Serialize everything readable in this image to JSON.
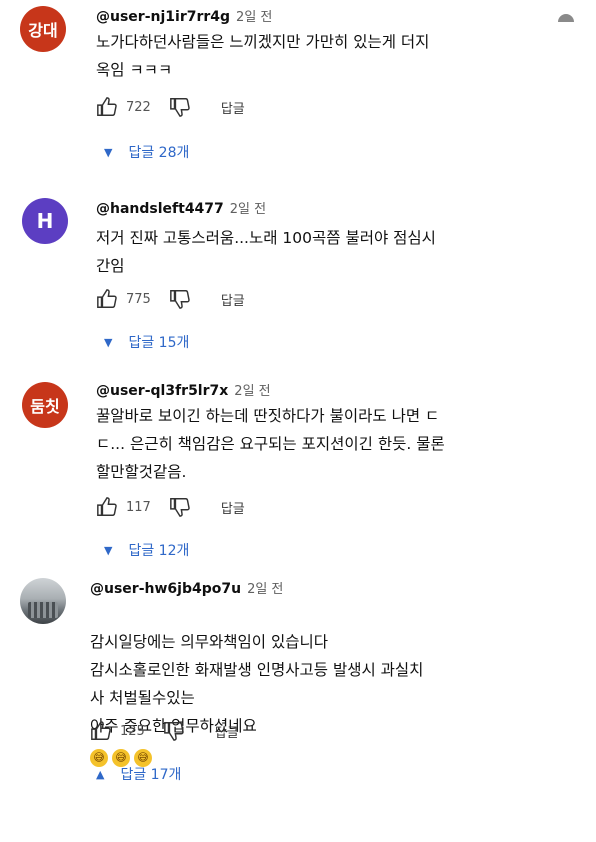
{
  "comments": [
    {
      "avatar_text": "강대",
      "avatar_color": "#c7361a",
      "handle": "@user-nj1ir7rr4g",
      "time": "2일 전",
      "text": "노가다하던사람들은 느끼겠지만 가만히 있는게 더지\n옥임 ㅋㅋㅋ",
      "likes": "722",
      "reply_label": "답글",
      "replies_label": "답글 28개"
    },
    {
      "avatar_text": "H",
      "avatar_color": "#5c3ec2",
      "handle": "@handsleft4477",
      "time": "2일 전",
      "text": "저거 진짜 고통스러움...노래 100곡쯤 불러야 점심시\n간임",
      "likes": "775",
      "reply_label": "답글",
      "replies_label": "답글 15개"
    },
    {
      "avatar_text": "둠칫",
      "avatar_color": "#c7361a",
      "handle": "@user-ql3fr5lr7x",
      "time": "2일 전",
      "text": "꿀알바로 보이긴 하는데 딴짓하다가 불이라도 나면 ㄷ\nㄷ... 은근히 책임감은 요구되는 포지션이긴 한듯. 물론\n할만할것같음.",
      "likes": "117",
      "reply_label": "답글",
      "replies_label": "답글 12개"
    },
    {
      "avatar_text": "",
      "avatar_color": "#9aa0a4",
      "handle": "@user-hw6jb4po7u",
      "time": "2일 전",
      "text": "감시일당에는 의무와책임이 있습니다\n감시소홀로인한 화재발생 인명사고등 발생시 과실치\n사 처벌될수있는\n아주 중요한 업무하셨네요",
      "emojis": [
        "😅",
        "😅",
        "😅"
      ],
      "likes": "125",
      "reply_label": "답글",
      "replies_label": "답글 17개"
    }
  ],
  "icons": {
    "like": "thumbs-up-icon",
    "dislike": "thumbs-down-icon",
    "collapse": "caret-down-icon",
    "expand": "caret-up-icon",
    "more": "more-icon"
  }
}
